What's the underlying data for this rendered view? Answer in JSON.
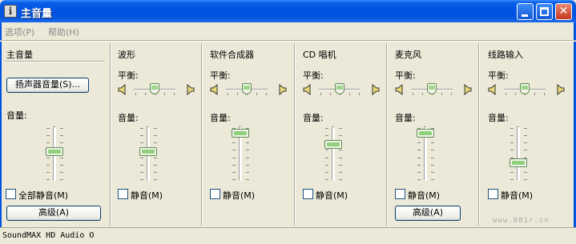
{
  "window": {
    "title": "主音量",
    "icon": "info-icon",
    "controls": [
      "minimize-icon",
      "maximize-icon",
      "close-icon"
    ]
  },
  "menu": {
    "options": "选项(P)",
    "help": "帮助(H)"
  },
  "master": {
    "title": "主音量",
    "speaker_button": "扬声器音量(S)...",
    "volume_label": "音量:",
    "volume_level": 0.55,
    "mute_all_label": "全部静音(M)",
    "advanced_button": "高级(A)"
  },
  "channels": [
    {
      "title": "波形",
      "balance_label": "平衡:",
      "balance": 0.5,
      "volume_label": "音量:",
      "volume_level": 0.55,
      "mute_label": "静音(M)"
    },
    {
      "title": "软件合成器",
      "balance_label": "平衡:",
      "balance": 0.5,
      "volume_label": "音量:",
      "volume_level": 0.95,
      "mute_label": "静音(M)"
    },
    {
      "title": "CD 唱机",
      "balance_label": "平衡:",
      "balance": 0.5,
      "volume_label": "音量:",
      "volume_level": 0.7,
      "mute_label": "静音(M)"
    },
    {
      "title": "麦克风",
      "balance_label": "平衡:",
      "balance": 0.5,
      "volume_label": "音量:",
      "volume_level": 0.95,
      "mute_label": "静音(M)",
      "advanced_button": "高级(A)"
    },
    {
      "title": "线路输入",
      "balance_label": "平衡:",
      "balance": 0.5,
      "volume_label": "音量:",
      "volume_level": 0.3,
      "mute_label": "静音(M)"
    }
  ],
  "status": {
    "device": "SoundMAX HD Audio O"
  },
  "watermark": "www.081r.cn",
  "colors": {
    "title_bar": "#0054E3",
    "window_bg": "#ECE9D8",
    "slider_accent": "#8FD07B"
  }
}
